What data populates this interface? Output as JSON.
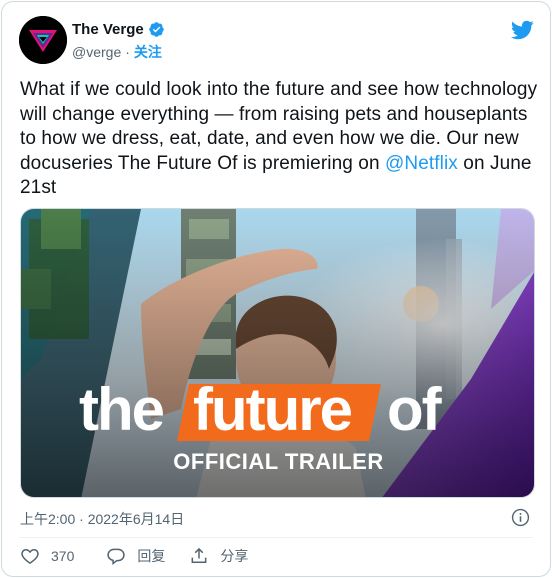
{
  "account": {
    "display_name": "The Verge",
    "handle": "@verge",
    "separator": "·",
    "follow_label": "关注",
    "verified": true
  },
  "tweet": {
    "text_before": "What if we could look into the future and see how technology will change everything — from raising pets and houseplants to how we dress, eat, date, and even how we die. Our new docuseries The Future Of is premiering on ",
    "mention": "@Netflix",
    "text_after": " on June 21st"
  },
  "media": {
    "title_the": "the",
    "title_future": "future",
    "title_of": "of",
    "subtitle": "OFFICIAL TRAILER"
  },
  "footer": {
    "timestamp": "上午2:00 · 2022年6月14日",
    "like_count": "370",
    "reply_label": "回复",
    "share_label": "分享"
  },
  "colors": {
    "brand_blue": "#1d9bf0",
    "title_orange": "#f26a1b",
    "text_primary": "#0f1419",
    "text_secondary": "#536471"
  },
  "icons": [
    "verge-logo-icon",
    "verified-badge-icon",
    "twitter-bird-icon",
    "info-icon",
    "heart-icon",
    "reply-icon",
    "share-icon"
  ]
}
